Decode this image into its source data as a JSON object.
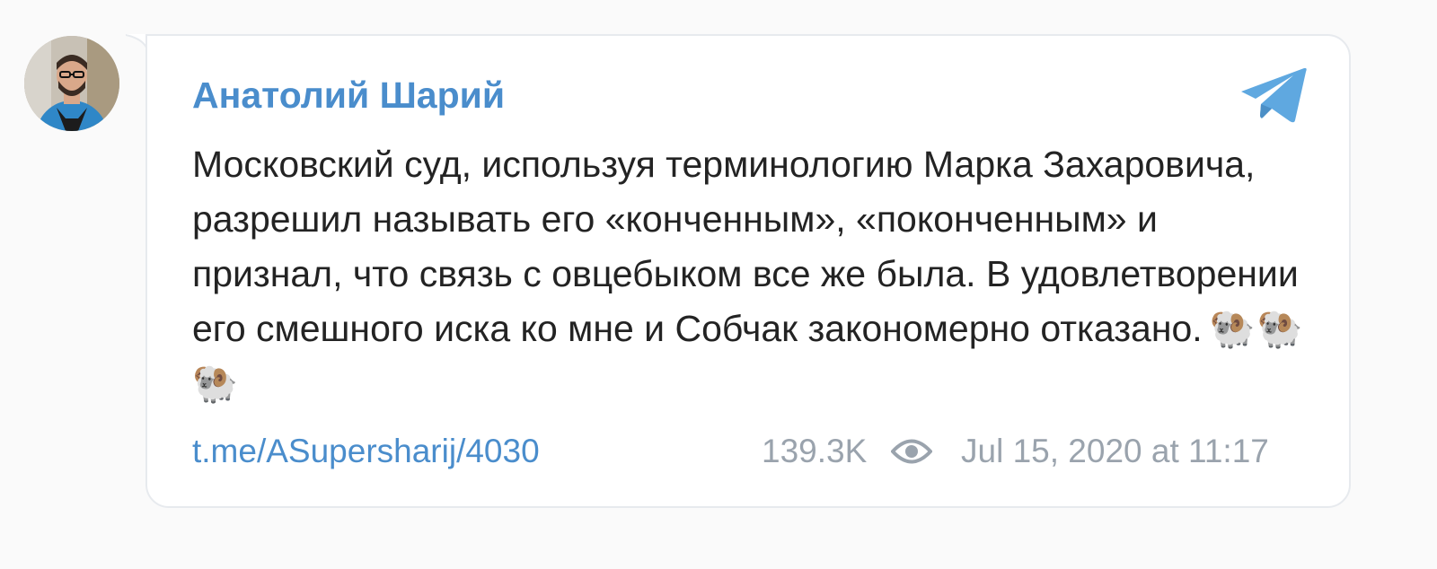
{
  "post": {
    "author": "Анатолий Шарий",
    "text": "Московский суд, используя терминологию Марка Захаровича, разрешил называть его «конченным», «поконченным» и признал, что связь с овцебыком все же была. В удовлетворении его смешного иска ко мне и Собчак закономерно отказано.",
    "emoji": "🐏🐏🐏",
    "link": "t.me/ASupersharij/4030",
    "views": "139.3K",
    "timestamp": "Jul 15, 2020 at 11:17"
  },
  "icons": {
    "brand": "telegram-icon",
    "views": "eye-icon"
  },
  "colors": {
    "accent": "#4a8dcc",
    "text": "#232323",
    "muted": "#9aa3ad",
    "border": "#e7eaee",
    "background": "#fafafa"
  }
}
